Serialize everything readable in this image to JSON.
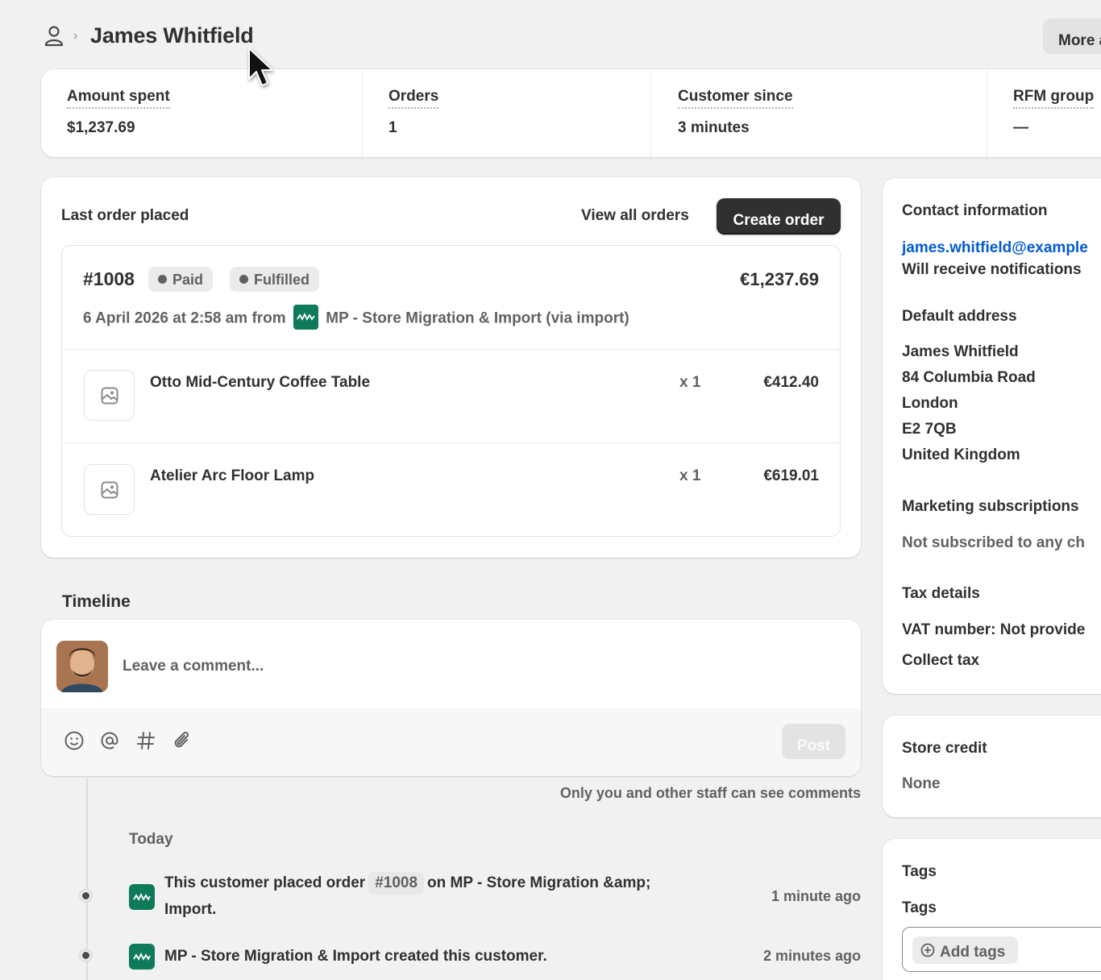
{
  "header": {
    "title": "James Whitfield",
    "breadcrumb_sep": "›",
    "more_label": "More a"
  },
  "stats": [
    {
      "label": "Amount spent",
      "value": "$1,237.69"
    },
    {
      "label": "Orders",
      "value": "1"
    },
    {
      "label": "Customer since",
      "value": "3 minutes"
    },
    {
      "label": "RFM group",
      "value": "—"
    }
  ],
  "last_order": {
    "title": "Last order placed",
    "view_all": "View all orders",
    "create_order": "Create order",
    "number": "#1008",
    "badges": [
      "Paid",
      "Fulfilled"
    ],
    "total": "€1,237.69",
    "date_prefix": "6 April 2026 at 2:58 am from",
    "source": "MP - Store Migration & Import (via import)",
    "items": [
      {
        "name": "Otto Mid-Century Coffee Table",
        "qty": "x 1",
        "price": "€412.40"
      },
      {
        "name": "Atelier Arc Floor Lamp",
        "qty": "x 1",
        "price": "€619.01"
      }
    ]
  },
  "timeline": {
    "title": "Timeline",
    "comment_placeholder": "Leave a comment...",
    "post_label": "Post",
    "staff_note": "Only you and other staff can see comments",
    "day_label": "Today",
    "events": [
      {
        "text_before": "This customer placed order",
        "chip": "#1008",
        "text_after": "on MP - Store Migration &amp;",
        "text_line2": "Import.",
        "time": "1 minute ago"
      },
      {
        "text_before": "MP - Store Migration & Import created this customer.",
        "time": "2 minutes ago"
      }
    ]
  },
  "contact": {
    "heading": "Contact information",
    "email": "james.whitfield@example",
    "notifications": "Will receive notifications",
    "address_heading": "Default address",
    "address_lines": [
      "James Whitfield",
      "84 Columbia Road",
      "London",
      "E2 7QB",
      "United Kingdom"
    ],
    "marketing_heading": "Marketing subscriptions",
    "marketing_text": "Not subscribed to any ch",
    "tax_heading": "Tax details",
    "vat_text": "VAT number: Not provide",
    "collect_tax": "Collect tax"
  },
  "store_credit": {
    "heading": "Store credit",
    "value": "None"
  },
  "tags": {
    "heading": "Tags",
    "label": "Tags",
    "add_label": "Add tags"
  },
  "colors": {
    "accent": "#0e7a5a",
    "link": "#005bd3",
    "primary_button": "#303030"
  }
}
